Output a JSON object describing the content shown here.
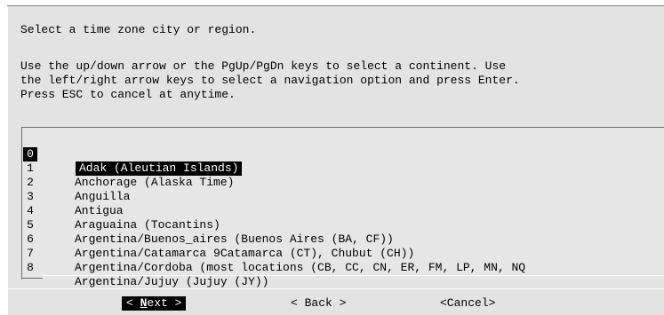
{
  "prompt": {
    "title": "Select a time zone city or region.",
    "instructions": [
      "Use the up/down arrow or the PgUp/PgDn keys to select a continent. Use",
      "the left/right arrow keys to select a navigation option and press Enter.",
      "Press ESC to cancel at anytime."
    ]
  },
  "list": {
    "selected_index": 0,
    "items": [
      {
        "num": "0",
        "name": "Adak (Aleutian Islands)"
      },
      {
        "num": "1",
        "name": "Anchorage (Alaska Time)"
      },
      {
        "num": "2",
        "name": "Anguilla"
      },
      {
        "num": "3",
        "name": "Antigua"
      },
      {
        "num": "4",
        "name": "Araguaina (Tocantins)"
      },
      {
        "num": "5",
        "name": "Argentina/Buenos_aires (Buenos Aires (BA, CF))"
      },
      {
        "num": "6",
        "name": "Argentina/Catamarca 9Catamarca (CT), Chubut (CH))"
      },
      {
        "num": "7",
        "name": "Argentina/Cordoba (most locations (CB, CC, CN, ER, FM, LP, MN, NQ"
      },
      {
        "num": "8",
        "name": "Argentina/Jujuy (Jujuy (JY))"
      }
    ]
  },
  "buttons": {
    "next_prefix": "< ",
    "next_hotkey": "N",
    "next_rest": "ext >",
    "back": "< Back >",
    "cancel": "<Cancel>"
  }
}
